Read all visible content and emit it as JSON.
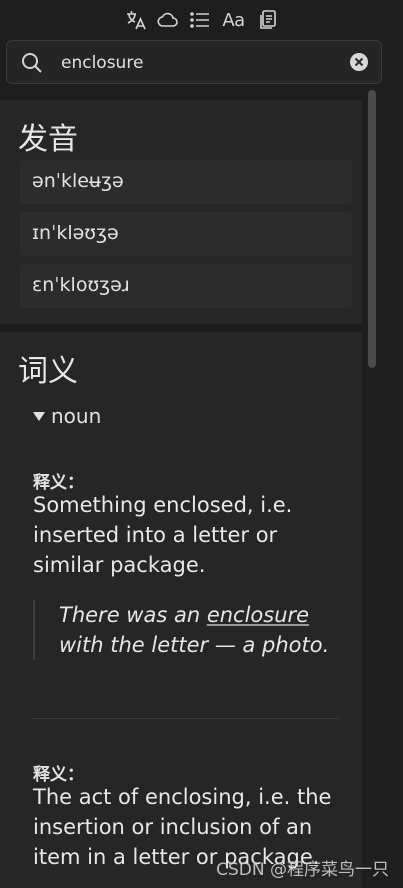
{
  "toolbar": {
    "icons": [
      "translate-icon",
      "cloud-icon",
      "list-icon",
      "font-size-icon",
      "copy-icon"
    ],
    "font_button_label": "Aa"
  },
  "search": {
    "value": "enclosure",
    "placeholder": ""
  },
  "pronunciation": {
    "title": "发音",
    "items": [
      "ənˈkleʉʒə",
      "ɪnˈkləʊʒə",
      "ɛnˈkloʊʒəɹ"
    ]
  },
  "definition": {
    "title": "词义",
    "part_of_speech": "noun",
    "senses": [
      {
        "label": "释义：",
        "text": "Something enclosed, i.e. inserted into a letter or similar package.",
        "example_before": "There was an ",
        "example_highlight": "enclosure",
        "example_after": " with the letter — a photo."
      },
      {
        "label": "释义：",
        "text": "The act of enclosing, i.e. the insertion or inclusion of an item in a letter or package."
      }
    ]
  },
  "watermark": "CSDN @程序菜鸟一只"
}
